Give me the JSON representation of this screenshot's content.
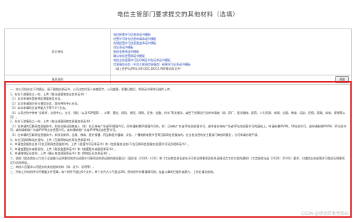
{
  "page": {
    "title": "电信主管部门要求提交的其他材料（选填）"
  },
  "form": {
    "other_materials_label": "其它材料",
    "templates": [
      "电信经营许可信息承诺书模板",
      "经营许可补办信息申请承诺书模板",
      "办理经营许可信息更变承诺书模板",
      "续证承诺书模板",
      "股权变更承诺书模板",
      "确认电信经营承诺书模板",
      "电信业务经营许可证印刷证书办证承诺书模板",
      "信息服务业务（不含互联网信息服务）经营许可证承诺书模板"
    ],
    "file_types_note": "（请上传JPG,JPEG,GIF,DOC,DOCX,PDF格式的文件）",
    "description_label": "填表说明",
    "browse_button": "浏览"
  },
  "notes": [
    "一、你公司如存在下列情况，请下载相应承诺书，公司法定代表人亲笔签字，公司盖章，签署日期后，将承诺书原件扫描件上传。",
    "1、存在下述情形之一的，上传《依法经营电信业务承诺书》：",
    "（1）本次申请的是跨地区增值电信业务。",
    "（2）本次申请国内多方通信业务、国内呼叫中心业务。",
    "（3）本次申请的业务种类大于等于4个业务。",
    "（4）公司名称中带有“交易所、交易中心、支付、保险（以及P2P国家）、众筹、基金、保险、期货、理财、证券、金融、约车”等关键字，或经下述情况行业的申请者（如：药厂、医疗器械、医药、人力资源、新闻、出版、教育、培训、民宿、家政、体育、视频等公司）。",
    "2、存在下述情形之一的，上传《依法经营网络信息服务承诺书》：",
    "（1）在申请的互联网信息服务中，如存在移动网络接入（如：在已持有广东省SP经营许可，同申请新增SP经营许可的，如：已持有广东省SP业务经营许可，或申请在持有广东省SP业务经营许可的基础上，申请新增IPVPN、SP业务许可，或申请新增IPVPN、SP业务许可，或申请新增广东省IPVPN业务经营许可，或申请新增广东省IPVPN业务经营许可。",
    "（2）在申请的互联网信息服务中，如涉及新闻、出版、教育、医疗保健、药品和医疗器械、文化、广播电影电视节目等互联网信息服务的，应当依法经有关主管部门审核同意后，方可申请办理手续。",
    "3、存在互联网移动应用的，上传《互联网移动应用信息承诺书》。",
    "4、申请信息服务业务(不含互联网信息服务)的，上传《经营许可证承诺书》和《信息服务业务(不含互联网信息服务)经营许可证办理承诺书》。",
    "5、申请变更股东或股权的，上传《股权变更承诺书》和《变更股东或股权承诺书》。",
    "6、申请跨地区业务的，上传《确认电信经营承诺书》和《跨地区业务承诺书》。",
    "二、依照《国务院办公厅关于全面推行证明事项和涉企经营许可事项告知承诺制的指导意见》（国办发〔2020〕42号）和《工业和信息化部关于印发证明事项告知承诺制试点工作方案的通知》（工信部政法函〔2020〕354号）要求，对通信业务经营许可相关证明事项实行告知承诺。",
    "三、审核人员要求公司提交的其他相关材料（如：证书、证明等）。",
    "三、所有上传的附件均不需要文件签章，每个附件不超过6个文件，单个文件大小不超过2M。所有附件均需清晰可辨，加盖公章的扫描件或照片，上传后请勿修改。"
  ],
  "watermark": "CSDN @移动开发老船长"
}
